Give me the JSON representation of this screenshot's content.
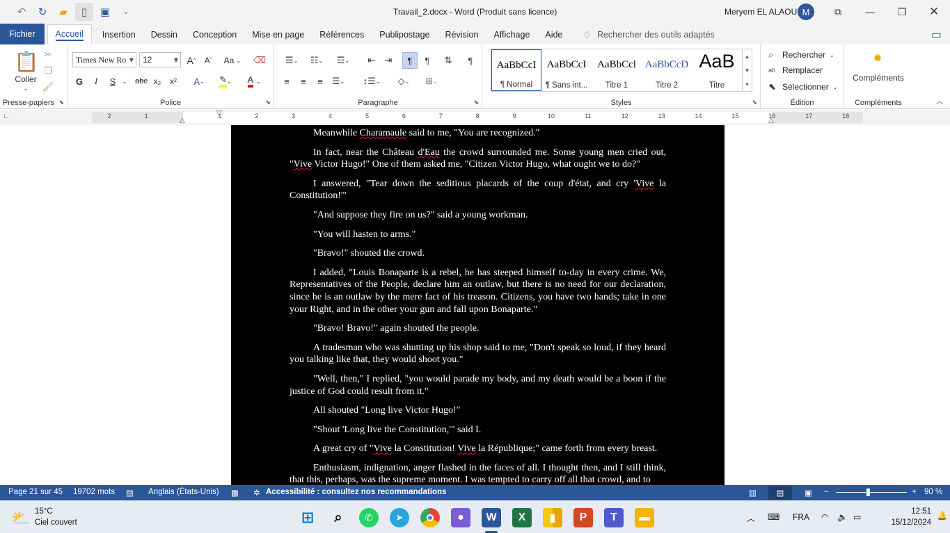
{
  "titlebar": {
    "document_title": "Travail_2.docx  -  Word (Produit sans licence)",
    "user_name": "Meryem EL ALAOUI",
    "user_initial": "M"
  },
  "tabs": [
    "Fichier",
    "Accueil",
    "Insertion",
    "Dessin",
    "Conception",
    "Mise en page",
    "Références",
    "Publipostage",
    "Révision",
    "Affichage",
    "Aide"
  ],
  "active_tab": "Accueil",
  "tell_me_placeholder": "Rechercher des outils adaptés",
  "ribbon": {
    "clipboard": {
      "paste_label": "Coller",
      "group_label": "Presse-papiers"
    },
    "font": {
      "font_name": "Times New Ro",
      "font_size": "12",
      "group_label": "Police",
      "bold": "G",
      "italic": "I",
      "underline": "S",
      "strike": "abc",
      "subscript": "x₂",
      "superscript": "x²",
      "case": "Aa"
    },
    "paragraph": {
      "group_label": "Paragraphe"
    },
    "styles": {
      "group_label": "Styles",
      "items": [
        {
          "preview": "AaBbCcI",
          "name": "¶ Normal"
        },
        {
          "preview": "AaBbCcI",
          "name": "¶ Sans int..."
        },
        {
          "preview": "AaBbCcl",
          "name": "Titre 1"
        },
        {
          "preview": "AaBbCcD",
          "name": "Titre 2"
        },
        {
          "preview": "AaB",
          "name": "Titre"
        }
      ]
    },
    "editing": {
      "group_label": "Édition",
      "find": "Rechercher",
      "replace": "Remplacer",
      "select": "Sélectionner"
    },
    "addins": {
      "label": "Compléments",
      "group_label": "Compléments"
    }
  },
  "ruler": {
    "labels": [
      "2",
      "1",
      "1",
      "2",
      "3",
      "4",
      "5",
      "6",
      "7",
      "8",
      "9",
      "10",
      "11",
      "12",
      "13",
      "14",
      "15",
      "16",
      "17",
      "18"
    ]
  },
  "document": {
    "paragraphs": [
      [
        {
          "t": "Meanwhile "
        },
        {
          "t": "Charamaule",
          "sq": true
        },
        {
          "t": " said to me, \"You are recognized.\""
        }
      ],
      [
        {
          "t": "In fact, near the Château "
        },
        {
          "t": "d'Eau",
          "sq": true
        },
        {
          "t": " the crowd surrounded me. Some young men cried out, \""
        },
        {
          "t": "Vive",
          "sq": true
        },
        {
          "t": " Victor Hugo!\" One of them asked me, \"Citizen Victor Hugo, what ought we to do?\""
        }
      ],
      [
        {
          "t": "I answered, \"Tear down the seditious placards of the coup d'état, and cry '"
        },
        {
          "t": "Vive",
          "sq": true
        },
        {
          "t": " la Constitution!'\""
        }
      ],
      [
        {
          "t": "\"And suppose they fire on us?\" said a young workman."
        }
      ],
      [
        {
          "t": "\"You will hasten to arms.\""
        }
      ],
      [
        {
          "t": "\"Bravo!\" shouted the crowd."
        }
      ],
      [
        {
          "t": "I added, \"Louis Bonaparte is a rebel, he has steeped himself to-day in every crime. We, Representatives of the People, declare him an outlaw, but there is no need for our declaration, since he is an outlaw by the mere fact of his treason. Citizens, you have two hands; take in one your Right, and in the other your gun and fall upon Bonaparte.\""
        }
      ],
      [
        {
          "t": "\"Bravo! Bravo!\" again shouted the people."
        }
      ],
      [
        {
          "t": "A tradesman who was shutting up his shop said to me, \"Don't speak so loud, if they heard you talking like that, they would shoot you.\""
        }
      ],
      [
        {
          "t": "\"Well, then,\" I replied, \"you would parade my body, and my death would be a boon if the justice of God could result from it.\""
        }
      ],
      [
        {
          "t": "All shouted \"Long live Victor Hugo!\""
        }
      ],
      [
        {
          "t": "\"Shout 'Long live the Constitution,'\" said I."
        }
      ],
      [
        {
          "t": "A great cry of \""
        },
        {
          "t": "Vive",
          "sq": true
        },
        {
          "t": " la Constitution! "
        },
        {
          "t": "Vive",
          "sq": true
        },
        {
          "t": " la République;\" came forth from every breast."
        }
      ],
      [
        {
          "t": "Enthusiasm, indignation, anger flashed in the faces of all. I thought then, and I still think, that this, perhaps, was the supreme moment. I was tempted to carry off all that crowd, and to"
        }
      ]
    ]
  },
  "statusbar": {
    "page": "Page 21 sur 45",
    "words": "19702 mots",
    "language": "Anglais (États-Unis)",
    "accessibility": "Accessibilité : consultez nos recommandations",
    "zoom": "90 %",
    "zoom_fraction": 0.45
  },
  "taskbar": {
    "temperature": "15°C",
    "weather": "Ciel couvert",
    "language": "FRA",
    "time": "12:51",
    "date": "15/12/2024"
  },
  "colors": {
    "accent": "#2b579a",
    "page_background": "#000000",
    "text": "#ffffff",
    "spellcheck": "#e81123"
  }
}
